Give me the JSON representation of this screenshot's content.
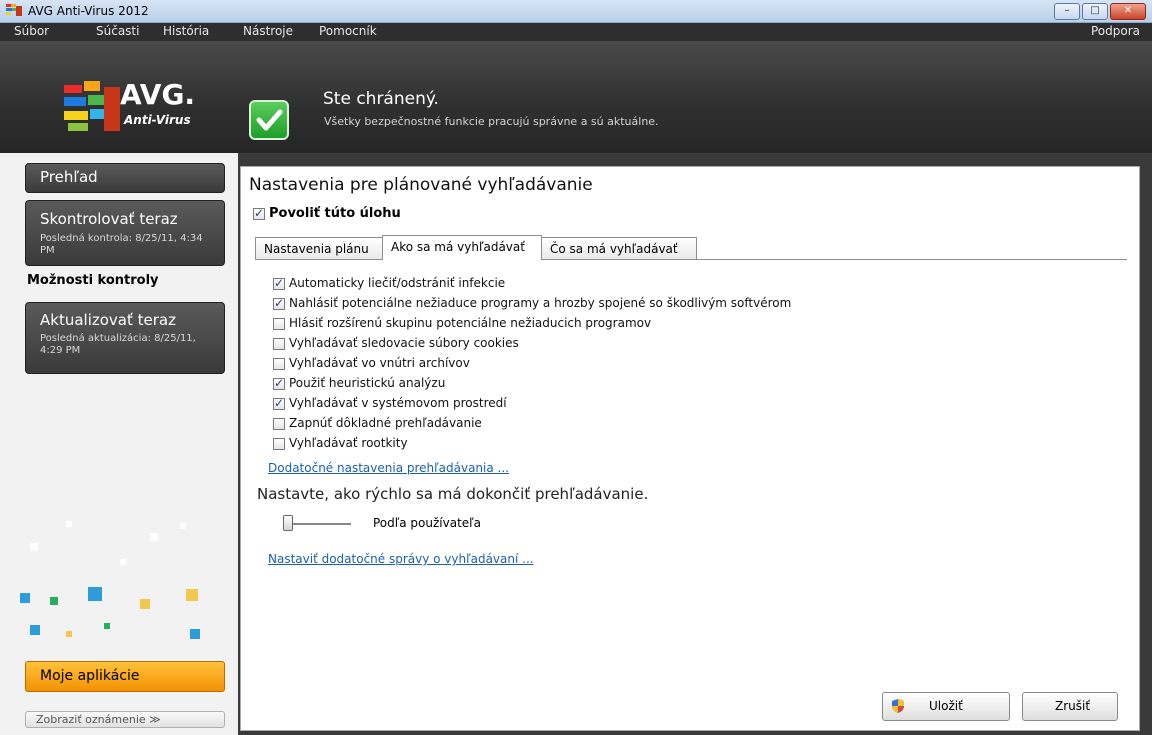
{
  "window": {
    "title": "AVG Anti-Virus 2012"
  },
  "menu": {
    "items": [
      "Súbor",
      "Súčasti",
      "História",
      "Nástroje",
      "Pomocník"
    ],
    "right": "Podpora"
  },
  "header": {
    "logo_word": "AVG.",
    "logo_sub": "Anti-Virus",
    "status_title": "Ste chránený.",
    "status_sub": "Všetky bezpečnostné funkcie pracujú správne a sú aktuálne."
  },
  "sidebar": {
    "overview": "Prehľad",
    "scan_now": "Skontrolovať teraz",
    "scan_last": "Posledná kontrola: 8/25/11, 4:34 PM",
    "scan_options": "Možnosti kontroly",
    "update_now": "Aktualizovať teraz",
    "update_last": "Posledná aktualizácia: 8/25/11, 4:29 PM",
    "my_apps": "Moje aplikácie",
    "show_notification": "Zobraziť oznámenie ≫"
  },
  "main": {
    "title": "Nastavenia pre plánované vyhľadávanie",
    "enable_task": {
      "label": "Povoliť túto úlohu",
      "checked": true
    },
    "tabs": [
      {
        "label": "Nastavenia plánu",
        "active": false
      },
      {
        "label": "Ako sa má vyhľadávať",
        "active": true
      },
      {
        "label": "Čo sa má vyhľadávať",
        "active": false
      }
    ],
    "options": [
      {
        "label": "Automaticky liečiť/odstrániť infekcie",
        "checked": true
      },
      {
        "label": "Nahlásiť potenciálne nežiaduce programy a hrozby spojené so škodlivým softvérom",
        "checked": true
      },
      {
        "label": "Hlásiť rozšírenú skupinu potenciálne nežiaducich programov",
        "checked": false
      },
      {
        "label": "Vyhľadávať sledovacie súbory cookies",
        "checked": false
      },
      {
        "label": "Vyhľadávať vo vnútri archívov",
        "checked": false
      },
      {
        "label": "Použiť heuristickú analýzu",
        "checked": true
      },
      {
        "label": "Vyhľadávať v systémovom prostredí",
        "checked": true
      },
      {
        "label": "Zapnúť dôkladné prehľadávanie",
        "checked": false
      },
      {
        "label": "Vyhľadávať rootkity",
        "checked": false
      }
    ],
    "advanced_link": "Dodatočné nastavenia prehľadávania ...",
    "speed_title": "Nastavte, ako rýchlo sa má dokončiť prehľadávanie.",
    "speed_value": "Podľa používateľa",
    "reports_link": "Nastaviť dodatočné správy o vyhľadávaní ...",
    "save_label": "Uložiť",
    "cancel_label": "Zrušiť"
  },
  "colors": {
    "accent_orange": "#f39203",
    "status_green": "#1e9e2a",
    "link_blue": "#1a5fb4"
  }
}
